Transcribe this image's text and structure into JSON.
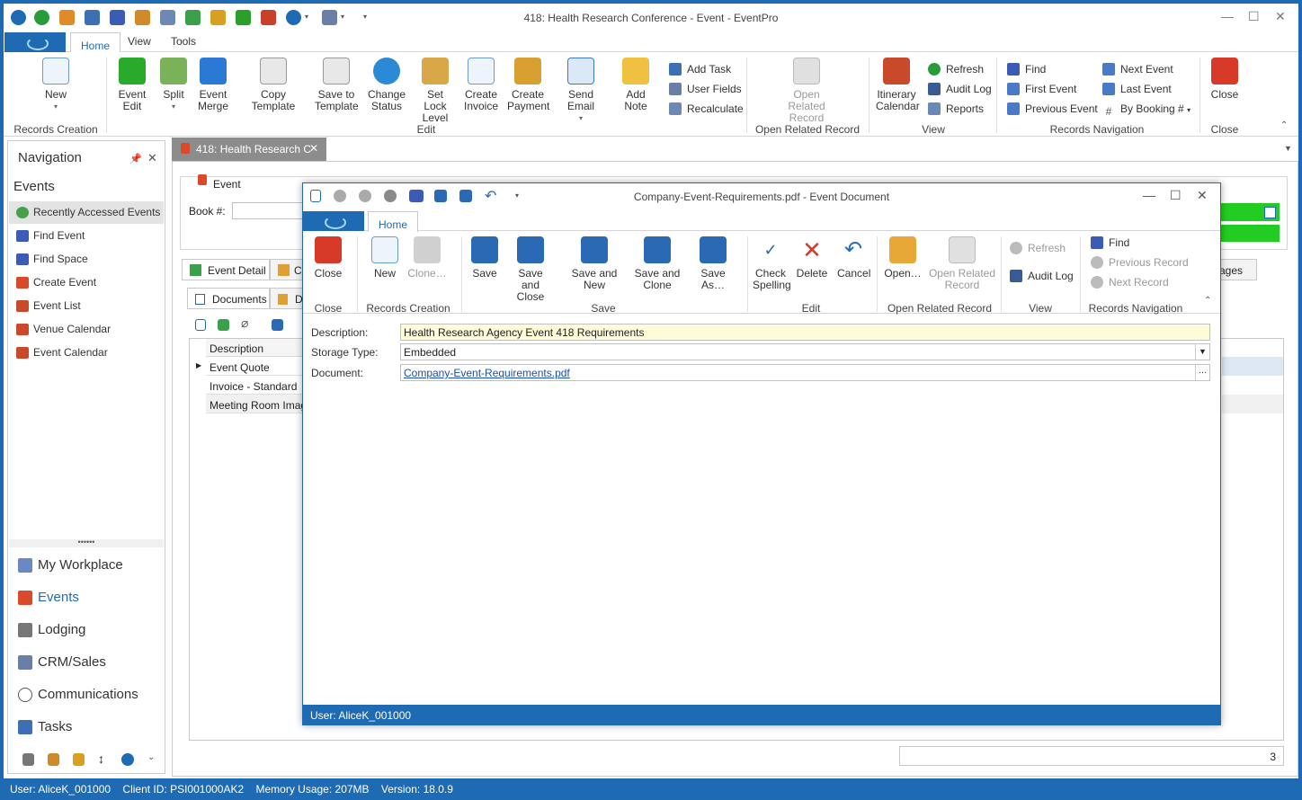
{
  "app": {
    "title": "418: Health Research Conference - Event - EventPro"
  },
  "menu": {
    "tabs": [
      "Home",
      "View",
      "Tools"
    ]
  },
  "ribbon": {
    "new": "New",
    "event_edit": "Event\nEdit",
    "split": "Split",
    "event_merge": "Event\nMerge",
    "copy_template": "Copy Template",
    "save_to_template": "Save to\nTemplate",
    "change_status": "Change\nStatus",
    "set_lock_level": "Set Lock\nLevel",
    "create_invoice": "Create\nInvoice",
    "create_payment": "Create\nPayment",
    "send_email": "Send Email",
    "add_note": "Add Note",
    "add_task": "Add Task",
    "user_fields": "User Fields",
    "recalculate": "Recalculate",
    "open_related_record": "Open Related\nRecord",
    "itinerary_calendar": "Itinerary\nCalendar",
    "refresh": "Refresh",
    "audit_log": "Audit Log",
    "reports": "Reports",
    "find": "Find",
    "first_event": "First Event",
    "previous_event": "Previous Event",
    "next_event": "Next Event",
    "last_event": "Last Event",
    "by_booking": "By Booking #",
    "close": "Close",
    "groups": {
      "records_creation": "Records Creation",
      "edit": "Edit",
      "open_related_record": "Open Related Record",
      "view": "View",
      "records_navigation": "Records Navigation",
      "close": "Close"
    }
  },
  "nav": {
    "title": "Navigation",
    "section": "Events",
    "items": [
      {
        "label": "Recently Accessed Events"
      },
      {
        "label": "Find Event"
      },
      {
        "label": "Find Space"
      },
      {
        "label": "Create Event"
      },
      {
        "label": "Event List"
      },
      {
        "label": "Venue Calendar"
      },
      {
        "label": "Event Calendar"
      }
    ],
    "modules": [
      {
        "label": "My Workplace"
      },
      {
        "label": "Events"
      },
      {
        "label": "Lodging"
      },
      {
        "label": "CRM/Sales"
      },
      {
        "label": "Communications"
      },
      {
        "label": "Tasks"
      }
    ]
  },
  "doc_tab": {
    "label": "418: Health Research C"
  },
  "event_form": {
    "event_label": "Event",
    "book_label": "Book #:",
    "tab_event_detail": "Event Detail",
    "tab_partial": "C",
    "tab_ages": "ages",
    "subtab_documents": "Documents",
    "subtab_partial": "D",
    "grid_header": "Description",
    "rows": [
      "Event Quote",
      "Invoice - Standard",
      "Meeting Room Image"
    ],
    "count": "3"
  },
  "dialog": {
    "title": "Company-Event-Requirements.pdf - Event Document",
    "tab": "Home",
    "ribbon": {
      "close": "Close",
      "new": "New",
      "clone": "Clone…",
      "save": "Save",
      "save_and_close": "Save and\nClose",
      "save_and_new": "Save and New",
      "save_and_clone": "Save and\nClone",
      "save_as": "Save As…",
      "check_spelling": "Check\nSpelling",
      "delete": "Delete",
      "cancel": "Cancel",
      "open": "Open…",
      "open_related_record": "Open Related\nRecord",
      "refresh": "Refresh",
      "audit_log": "Audit Log",
      "find": "Find",
      "previous_record": "Previous Record",
      "next_record": "Next Record",
      "groups": {
        "close": "Close",
        "records_creation": "Records Creation",
        "save": "Save",
        "edit": "Edit",
        "open_related_record": "Open Related Record",
        "view": "View",
        "records_navigation": "Records Navigation"
      }
    },
    "fields": {
      "description_label": "Description:",
      "description_value": "Health Research Agency Event 418 Requirements",
      "storage_label": "Storage Type:",
      "storage_value": "Embedded",
      "document_label": "Document:",
      "document_value": "Company-Event-Requirements.pdf"
    },
    "status": "User: AliceK_001000"
  },
  "status": {
    "text": "User: AliceK_001000    Client ID: PSI001000AK2    Memory Usage: 207MB    Version: 18.0.9"
  },
  "colors": {
    "accent": "#1e6ab3",
    "green": "#22cc22"
  }
}
